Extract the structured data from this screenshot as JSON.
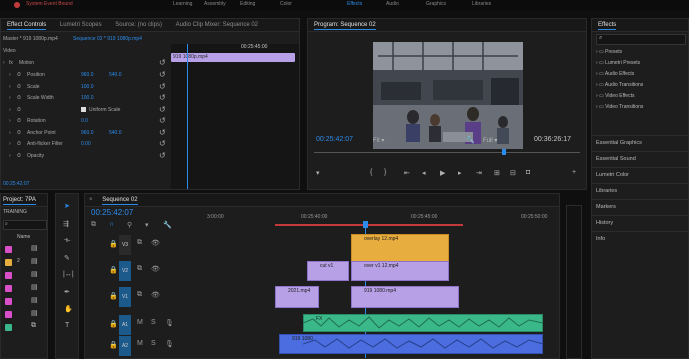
{
  "workspace": {
    "items": [
      "System Event Bound",
      "Learning",
      "Assembly",
      "Editing",
      "Color",
      "Effects",
      "Audio",
      "Graphics",
      "Libraries"
    ],
    "active": "Effects"
  },
  "effect_controls": {
    "tabs": [
      "Effect Controls",
      "Lumetri Scopes",
      "Source: (no clips)",
      "Audio Clip Mixer: Sequence 02"
    ],
    "master_label": "Master * 919 1080p.mp4",
    "sequence_label": "Sequence 02 * 919 1080p.mp4",
    "clip_chip": "919 1080p.mp4",
    "ruler_time": "00:25:45:00",
    "section_video": "Video",
    "fx_motion": "Motion",
    "props": [
      {
        "name": "Position",
        "v1": "960.0",
        "v2": "540.0"
      },
      {
        "name": "Scale",
        "v1": "100.0",
        "v2": ""
      },
      {
        "name": "Scale Width",
        "v1": "100.0",
        "v2": ""
      },
      {
        "name": "Uniform Scale",
        "v1": "",
        "v2": ""
      },
      {
        "name": "Rotation",
        "v1": "0.0",
        "v2": ""
      },
      {
        "name": "Anchor Point",
        "v1": "960.0",
        "v2": "540.0"
      },
      {
        "name": "Anti-flicker Filter",
        "v1": "0.00",
        "v2": ""
      },
      {
        "name": "Opacity",
        "v1": "",
        "v2": ""
      }
    ],
    "timecode": "00:25:42:07"
  },
  "program": {
    "tab": "Program: Sequence 02",
    "timecode": "00:25:42:07",
    "fit": "Fit",
    "quality": "Full",
    "duration": "00:36:26:17"
  },
  "effects_panel": {
    "title": "Effects",
    "search_placeholder": "",
    "folders": [
      "Presets",
      "Lumetri Presets",
      "Audio Effects",
      "Audio Transitions",
      "Video Effects",
      "Video Transitions"
    ],
    "sections": [
      "Essential Graphics",
      "Essential Sound",
      "Lumetri Color",
      "Libraries",
      "Markers",
      "History",
      "Info"
    ]
  },
  "project": {
    "tabs": [
      "Project: 7PA",
      "Media Browser"
    ],
    "filename": "7PA.prproj",
    "tab2": "TRAINING",
    "col_name": "Name",
    "bins": [
      {
        "color": "#d94fc8",
        "label": ""
      },
      {
        "color": "#e8ad3f",
        "label": "2"
      },
      {
        "color": "#d94fc8",
        "label": ""
      },
      {
        "color": "#d94fc8",
        "label": ""
      },
      {
        "color": "#d94fc8",
        "label": ""
      },
      {
        "color": "#d94fc8",
        "label": ""
      },
      {
        "color": "#3bb88a",
        "label": ""
      }
    ]
  },
  "timeline": {
    "tab": "Sequence 02",
    "timecode": "00:25:42:07",
    "ruler": [
      "3:00:00",
      "00:25:40:00",
      "00:25:45:00",
      "00:25:50:00"
    ],
    "tracks": [
      "V3",
      "V2",
      "V1",
      "A1",
      "A2"
    ],
    "clips": {
      "v3": "overlay 12.mp4",
      "v2a": "cut v1",
      "v2b": "over v1 12.mp4",
      "v1a": "2021.mp4",
      "v1b": "919 1080.mp4",
      "a1": "FX",
      "a2": "919 1080"
    },
    "colors": {
      "video": "#e8ad3f",
      "purple": "#b8a0e6",
      "audio": "#3bb88a",
      "audio2": "#4c6de0",
      "playhead": "#2d8ceb"
    }
  }
}
